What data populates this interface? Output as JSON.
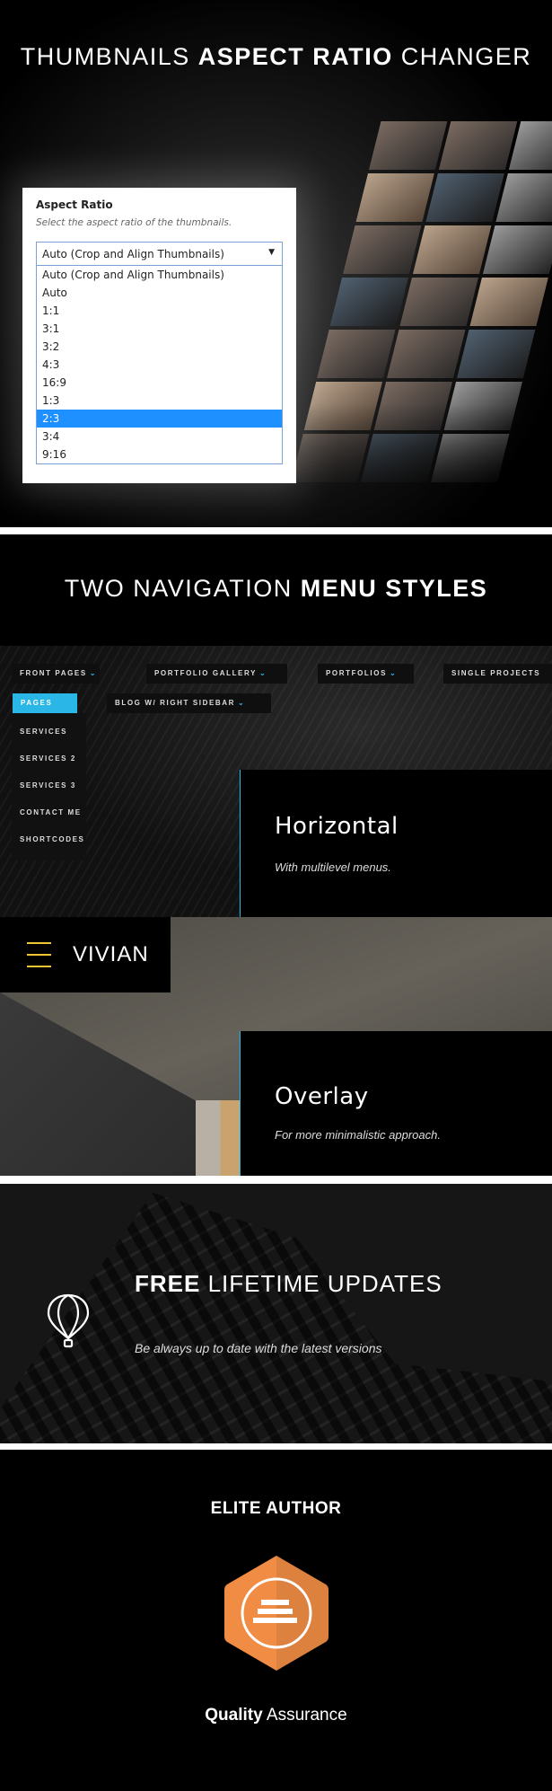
{
  "section1": {
    "title_light_1": "THUMBNAILS",
    "title_bold": "ASPECT RATIO",
    "title_light_2": "CHANGER",
    "panel": {
      "label": "Aspect Ratio",
      "description": "Select the aspect ratio of the thumbnails.",
      "selected_value": "Auto (Crop and Align Thumbnails)",
      "options": [
        "Auto (Crop and Align Thumbnails)",
        "Auto",
        "1:1",
        "3:1",
        "3:2",
        "4:3",
        "16:9",
        "1:3",
        "2:3",
        "3:4",
        "9:16"
      ],
      "highlighted_option": "2:3",
      "highlight_color": "#1e90ff"
    }
  },
  "section2": {
    "title_light": "TWO NAVIGATION",
    "title_bold": "MENU STYLES",
    "accent_color": "#2ab6e6",
    "nav_items": [
      "FRONT PAGES",
      "PORTFOLIO GALLERY",
      "PORTFOLIOS",
      "SINGLE PROJECTS",
      "PAGES",
      "BLOG W/ RIGHT SIDEBAR"
    ],
    "chevron_icon": "chevron-down-icon",
    "chevron_glyph": "⌄",
    "dropdown_items": [
      "SERVICES",
      "SERVICES 2",
      "SERVICES 3",
      "CONTACT ME",
      "SHORTCODES"
    ],
    "horizontal": {
      "title": "Horizontal",
      "subtitle": "With multilevel menus."
    },
    "logo": "VIVIAN",
    "hamburger_color": "#f0c330",
    "overlay": {
      "title": "Overlay",
      "subtitle": "For more minimalistic approach."
    }
  },
  "section3": {
    "title_bold": "FREE",
    "title_light": "LIFETIME UPDATES",
    "subtitle": "Be always up to date with the latest versions",
    "icon": "hot-air-balloon-icon"
  },
  "section4": {
    "title": "ELITE AUTHOR",
    "badge_color": "#f08c44",
    "footer_bold": "Quality",
    "footer_light": "Assurance"
  }
}
